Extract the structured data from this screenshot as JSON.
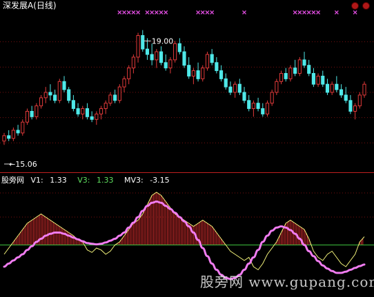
{
  "header": {
    "title": "深发展A",
    "subtitle": "(日线)"
  },
  "indicator_legend": {
    "name": "股旁网",
    "v1_label": "V1:",
    "v1_value": "1.33",
    "v3_label": "V3:",
    "v3_value": "1.33",
    "mv3_label": "MV3:",
    "mv3_value": "-3.15"
  },
  "watermark": "股旁网  www.gupang.com",
  "colors": {
    "up": "#e23a3a",
    "down": "#4fe8e8",
    "signal": "#d64ad6",
    "v1": "#f2f27a",
    "v3_bar": "#e03030",
    "mv3": "#f07cf0",
    "zero": "#3ec43e",
    "separator": "#c02020",
    "grid": "#7a1010"
  },
  "chart_data": [
    {
      "type": "candlestick",
      "title": "深发展A (日线)",
      "ylim": [
        14.2,
        19.8
      ],
      "annotations": [
        {
          "label": "19.00",
          "value": 19.0,
          "kind": "high"
        },
        {
          "label": "15.06",
          "value": 15.06,
          "kind": "low"
        }
      ],
      "candles": [
        [
          15.2,
          15.5,
          15.06,
          15.4
        ],
        [
          15.4,
          15.6,
          15.2,
          15.3
        ],
        [
          15.3,
          15.7,
          15.2,
          15.6
        ],
        [
          15.6,
          15.8,
          15.4,
          15.5
        ],
        [
          15.5,
          16.0,
          15.4,
          15.9
        ],
        [
          15.9,
          16.4,
          15.8,
          16.3
        ],
        [
          16.3,
          16.5,
          16.0,
          16.1
        ],
        [
          16.1,
          16.6,
          16.0,
          16.5
        ],
        [
          16.5,
          16.9,
          16.4,
          16.8
        ],
        [
          16.8,
          17.2,
          16.6,
          17.0
        ],
        [
          17.0,
          17.3,
          16.7,
          16.9
        ],
        [
          16.9,
          17.1,
          16.6,
          16.7
        ],
        [
          16.7,
          17.5,
          16.6,
          17.4
        ],
        [
          17.4,
          17.6,
          17.0,
          17.1
        ],
        [
          17.1,
          17.2,
          16.6,
          16.7
        ],
        [
          16.7,
          16.9,
          16.3,
          16.4
        ],
        [
          16.4,
          16.6,
          16.1,
          16.2
        ],
        [
          16.2,
          16.5,
          16.0,
          16.4
        ],
        [
          16.4,
          16.6,
          16.0,
          16.1
        ],
        [
          16.1,
          16.3,
          15.9,
          16.0
        ],
        [
          16.0,
          16.3,
          15.8,
          16.2
        ],
        [
          16.2,
          16.5,
          16.0,
          16.4
        ],
        [
          16.4,
          16.7,
          16.2,
          16.6
        ],
        [
          16.6,
          17.0,
          16.5,
          16.9
        ],
        [
          16.9,
          17.1,
          16.6,
          16.7
        ],
        [
          16.7,
          17.3,
          16.6,
          17.2
        ],
        [
          17.2,
          17.6,
          17.0,
          17.5
        ],
        [
          17.5,
          18.0,
          17.3,
          17.9
        ],
        [
          17.9,
          18.4,
          17.7,
          18.3
        ],
        [
          18.3,
          19.2,
          18.1,
          19.1
        ],
        [
          19.1,
          19.3,
          18.5,
          18.6
        ],
        [
          18.6,
          19.0,
          18.2,
          18.4
        ],
        [
          18.4,
          18.8,
          18.0,
          18.2
        ],
        [
          18.2,
          18.6,
          17.9,
          18.5
        ],
        [
          18.5,
          18.7,
          18.0,
          18.1
        ],
        [
          18.1,
          18.4,
          17.8,
          17.9
        ],
        [
          17.9,
          18.3,
          17.7,
          18.2
        ],
        [
          18.2,
          18.9,
          18.1,
          18.8
        ],
        [
          18.8,
          19.0,
          18.4,
          18.5
        ],
        [
          18.5,
          18.7,
          17.9,
          18.0
        ],
        [
          18.0,
          18.3,
          17.5,
          17.6
        ],
        [
          17.6,
          17.9,
          17.3,
          17.8
        ],
        [
          17.8,
          18.1,
          17.4,
          17.5
        ],
        [
          17.5,
          18.0,
          17.4,
          17.9
        ],
        [
          17.9,
          18.5,
          17.8,
          18.4
        ],
        [
          18.4,
          18.6,
          18.0,
          18.1
        ],
        [
          18.1,
          18.3,
          17.7,
          17.8
        ],
        [
          17.8,
          18.0,
          17.4,
          17.5
        ],
        [
          17.5,
          17.7,
          17.1,
          17.2
        ],
        [
          17.2,
          17.4,
          16.9,
          17.0
        ],
        [
          17.0,
          17.4,
          16.8,
          17.3
        ],
        [
          17.3,
          17.5,
          16.9,
          17.0
        ],
        [
          17.0,
          17.2,
          16.6,
          16.7
        ],
        [
          16.7,
          16.9,
          16.3,
          16.4
        ],
        [
          16.4,
          16.7,
          16.1,
          16.6
        ],
        [
          16.6,
          16.8,
          16.3,
          16.4
        ],
        [
          16.4,
          16.6,
          16.1,
          16.2
        ],
        [
          16.2,
          16.7,
          16.1,
          16.6
        ],
        [
          16.6,
          17.1,
          16.5,
          17.0
        ],
        [
          17.0,
          17.5,
          16.9,
          17.4
        ],
        [
          17.4,
          17.8,
          17.3,
          17.7
        ],
        [
          17.7,
          17.9,
          17.4,
          17.5
        ],
        [
          17.5,
          18.0,
          17.4,
          17.9
        ],
        [
          17.9,
          18.2,
          17.6,
          17.7
        ],
        [
          17.7,
          18.3,
          17.6,
          18.2
        ],
        [
          18.2,
          18.5,
          17.9,
          18.0
        ],
        [
          18.0,
          18.2,
          17.6,
          17.7
        ],
        [
          17.7,
          17.9,
          17.2,
          17.3
        ],
        [
          17.3,
          17.7,
          17.2,
          17.6
        ],
        [
          17.6,
          17.8,
          17.2,
          17.3
        ],
        [
          17.3,
          17.5,
          16.9,
          17.0
        ],
        [
          17.0,
          17.4,
          16.9,
          17.3
        ],
        [
          17.3,
          17.6,
          17.0,
          17.1
        ],
        [
          17.1,
          17.3,
          16.8,
          16.9
        ],
        [
          16.9,
          17.2,
          16.6,
          16.7
        ],
        [
          16.7,
          16.9,
          16.2,
          16.3
        ],
        [
          16.3,
          16.6,
          16.0,
          16.5
        ],
        [
          16.5,
          17.0,
          16.4,
          16.9
        ],
        [
          16.9,
          17.4,
          16.8,
          17.3
        ]
      ]
    },
    {
      "type": "line",
      "series": [
        {
          "name": "V1",
          "values": [
            -1.5,
            -0.5,
            0.5,
            1.5,
            2.5,
            3.5,
            4.0,
            4.5,
            5.0,
            4.5,
            4.0,
            3.5,
            3.0,
            2.5,
            2.0,
            1.5,
            0.8,
            0.5,
            -0.8,
            -1.2,
            -0.5,
            -0.8,
            -1.5,
            -1.0,
            0.0,
            0.5,
            1.5,
            2.5,
            3.5,
            4.0,
            5.0,
            6.5,
            8.0,
            8.5,
            8.0,
            7.0,
            6.0,
            5.0,
            4.5,
            4.0,
            3.5,
            3.0,
            3.5,
            4.0,
            3.5,
            3.0,
            2.0,
            1.0,
            0.0,
            -1.0,
            -1.5,
            -2.0,
            -2.5,
            -2.0,
            -3.5,
            -4.0,
            -3.0,
            -1.5,
            -0.5,
            0.5,
            2.0,
            3.5,
            4.0,
            3.5,
            3.0,
            2.5,
            1.0,
            -1.0,
            -2.0,
            -2.5,
            -1.5,
            -1.0,
            -2.0,
            -3.0,
            -3.5,
            -2.5,
            -1.5,
            0.5,
            1.33
          ]
        },
        {
          "name": "MV3",
          "values": [
            -3.5,
            -3.0,
            -2.5,
            -2.0,
            -1.5,
            -0.8,
            -0.2,
            0.5,
            1.0,
            1.5,
            1.8,
            2.0,
            2.0,
            1.8,
            1.5,
            1.2,
            0.9,
            0.6,
            0.3,
            0.2,
            0.1,
            0.2,
            0.4,
            0.7,
            1.0,
            1.5,
            2.0,
            2.8,
            3.6,
            4.5,
            5.5,
            6.3,
            6.8,
            7.0,
            6.8,
            6.3,
            5.8,
            5.2,
            4.5,
            3.8,
            3.0,
            2.0,
            0.8,
            -0.5,
            -1.8,
            -3.0,
            -4.0,
            -4.8,
            -5.3,
            -5.5,
            -5.3,
            -4.8,
            -4.0,
            -3.0,
            -2.0,
            -0.8,
            0.5,
            1.5,
            2.3,
            2.8,
            3.0,
            2.8,
            2.4,
            1.8,
            1.0,
            0.0,
            -1.0,
            -1.8,
            -2.6,
            -3.3,
            -3.8,
            -4.2,
            -4.5,
            -4.5,
            -4.3,
            -4.0,
            -3.7,
            -3.4,
            -3.15
          ]
        }
      ]
    }
  ]
}
